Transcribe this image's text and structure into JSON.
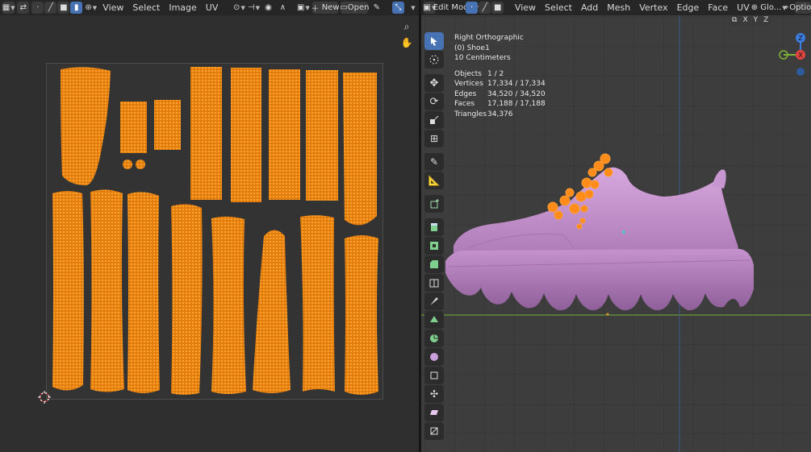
{
  "uv_editor": {
    "header": {
      "menus": [
        "View",
        "Select",
        "Image",
        "UV"
      ],
      "new_label": "New",
      "open_label": "Open"
    }
  },
  "viewport": {
    "header": {
      "mode_label": "Edit Mode",
      "menus": [
        "View",
        "Select",
        "Add",
        "Mesh",
        "Vertex",
        "Edge",
        "Face",
        "UV"
      ],
      "orientation_label": "Glo...",
      "options_label": "Option",
      "xyz": [
        "X",
        "Y",
        "Z"
      ]
    },
    "overlay": {
      "view_name": "Right Orthographic",
      "object_name": "(0) Shoe1",
      "scale_label": "10 Centimeters",
      "stats": [
        {
          "label": "Objects",
          "value": "1 / 2"
        },
        {
          "label": "Vertices",
          "value": "17,334 / 17,334"
        },
        {
          "label": "Edges",
          "value": "34,520 / 34,520"
        },
        {
          "label": "Faces",
          "value": "17,188 / 17,188"
        },
        {
          "label": "Triangles",
          "value": "34,376"
        }
      ]
    },
    "gizmo": {
      "z": "Z",
      "x": "X"
    }
  },
  "colors": {
    "uv_island": "#ff8a10",
    "shoe": "#c795cf",
    "shoe_shadow": "#9b6aa6",
    "active": "#4772b3",
    "axis_x": "#e0443e",
    "axis_y": "#7fb23a",
    "axis_z": "#3d7de0"
  }
}
